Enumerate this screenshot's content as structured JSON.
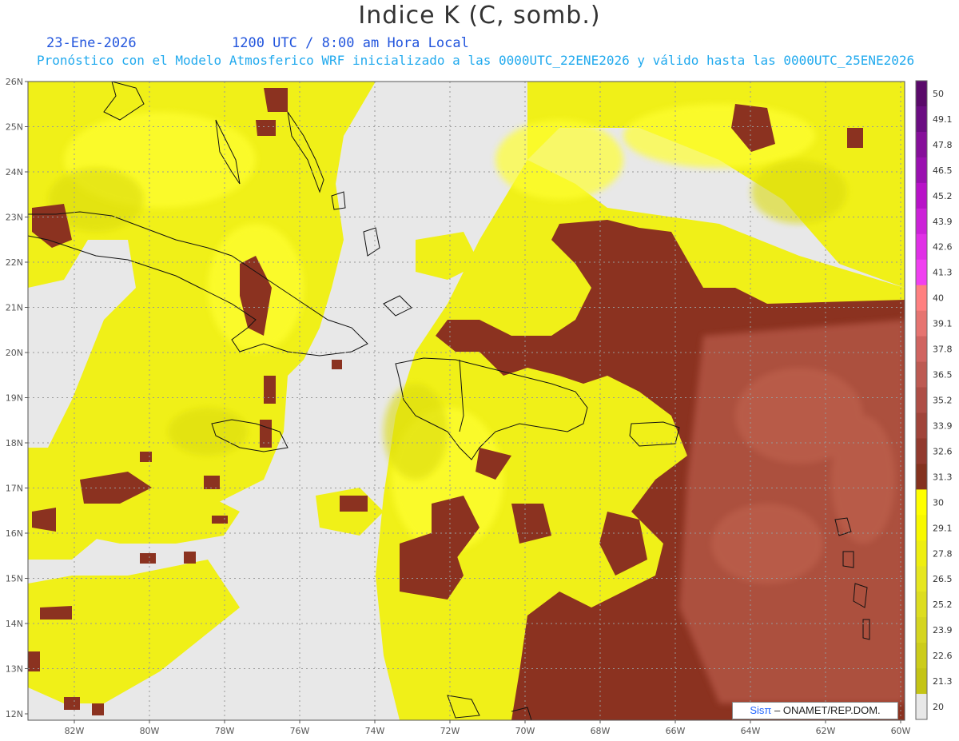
{
  "header": {
    "title": "Indice K (C, somb.)",
    "date": "23-Ene-2026",
    "time": "1200 UTC / 8:00 am Hora Local",
    "subtitle": "Pronóstico con el Modelo Atmosferico WRF inicializado a las 0000UTC_22ENE2026 y válido hasta las  0000UTC_25ENE2026"
  },
  "axes": {
    "lon_labels": [
      "82W",
      "80W",
      "78W",
      "76W",
      "74W",
      "72W",
      "70W",
      "68W",
      "66W",
      "64W",
      "62W",
      "60W"
    ],
    "lat_labels": [
      "26N",
      "25N",
      "24N",
      "23N",
      "22N",
      "21N",
      "20N",
      "19N",
      "18N",
      "17N",
      "16N",
      "15N",
      "14N",
      "13N",
      "12N"
    ]
  },
  "colorbar": {
    "labels": [
      "50",
      "49.1",
      "47.8",
      "46.5",
      "45.2",
      "43.9",
      "42.6",
      "41.3",
      "40",
      "39.1",
      "37.8",
      "36.5",
      "35.2",
      "33.9",
      "32.6",
      "31.3",
      "30",
      "29.1",
      "27.8",
      "26.5",
      "25.2",
      "23.9",
      "22.6",
      "21.3",
      "20"
    ],
    "colors": [
      "#5a0a6a",
      "#6b0d82",
      "#860f9a",
      "#9a10b0",
      "#b812c8",
      "#cc22d8",
      "#e030e6",
      "#f040f0",
      "#ff8080",
      "#e67470",
      "#d06460",
      "#bd5a52",
      "#ae4e46",
      "#a0443a",
      "#923a2e",
      "#84321f",
      "#ffff00",
      "#f8f800",
      "#eeee10",
      "#e6e620",
      "#dddd20",
      "#d5d520",
      "#cccc1a",
      "#c4c415",
      "#e8e8e8"
    ]
  },
  "credit": {
    "brand": "Sisπ",
    "agency": "– ONAMET/REP.DOM."
  }
}
